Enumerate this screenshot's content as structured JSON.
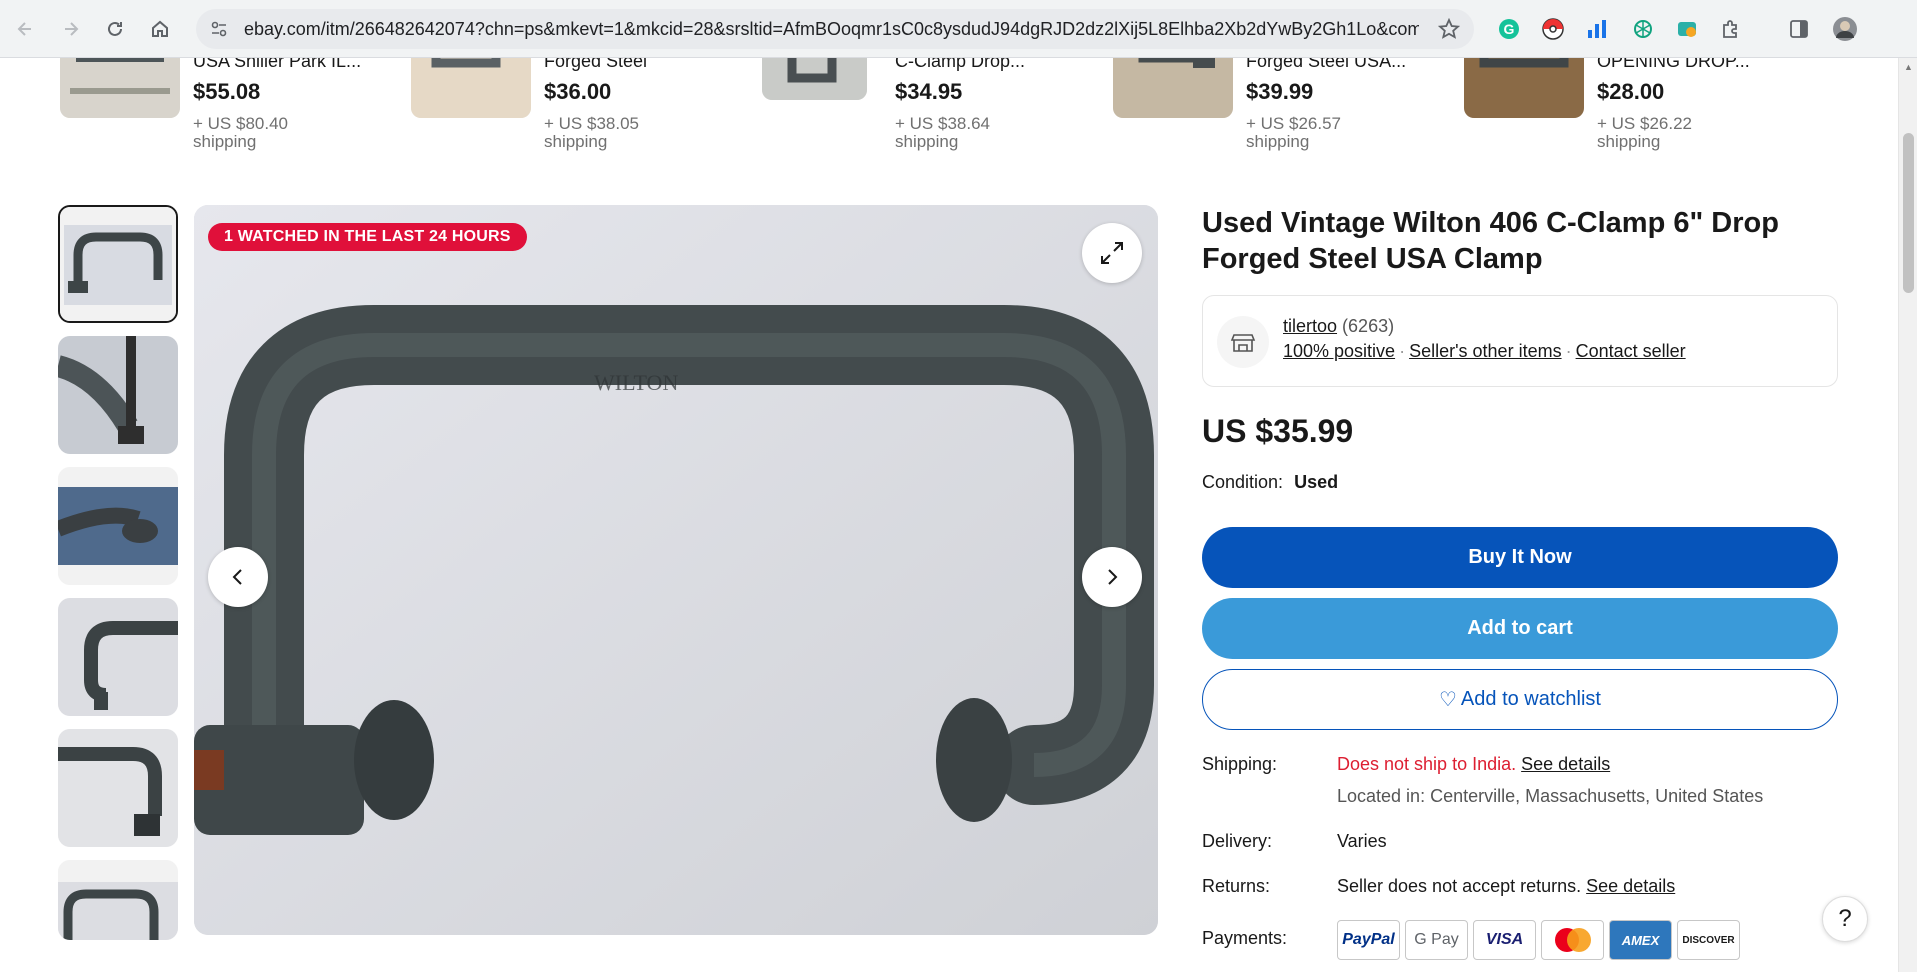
{
  "browser": {
    "url": "ebay.com/itm/266482642074?chn=ps&mkevt=1&mkcid=28&srsltid=AfmBOoqmr1sC0c8ysdudJ94dgRJD2dz2lXij5L8Elhba2Xb2dYwBy2Gh1Lo&com_cvv...",
    "back_icon": "back-arrow-icon",
    "forward_icon": "forward-arrow-icon",
    "reload_icon": "reload-icon",
    "home_icon": "home-icon"
  },
  "similar_items": [
    {
      "title": "USA Shiller Park IL...",
      "price": "$55.08",
      "shipping_line1": "+ US $80.40",
      "shipping_line2": "shipping"
    },
    {
      "title": "Forged Steel",
      "price": "$36.00",
      "shipping_line1": "+ US $38.05",
      "shipping_line2": "shipping"
    },
    {
      "title": "C-Clamp Drop...",
      "price": "$34.95",
      "shipping_line1": "+ US $38.64",
      "shipping_line2": "shipping"
    },
    {
      "title": "Forged Steel USA...",
      "price": "$39.99",
      "shipping_line1": "+ US $26.57",
      "shipping_line2": "shipping"
    },
    {
      "title": "OPENING DROP...",
      "price": "$28.00",
      "shipping_line1": "+ US $26.22",
      "shipping_line2": "shipping"
    }
  ],
  "gallery": {
    "badge": "1 WATCHED IN THE LAST 24 HOURS",
    "image_alt": "WILTON",
    "thumbnail_count": 6
  },
  "product": {
    "title": "Used Vintage Wilton 406 C-Clamp 6\" Drop Forged Steel USA Clamp",
    "seller_name": "tilertoo",
    "seller_feedback": "(6263)",
    "seller_positive": "100% positive",
    "seller_other_items": "Seller's other items",
    "contact_seller": "Contact seller",
    "price": "US $35.99",
    "condition_label": "Condition:",
    "condition_value": "Used",
    "buy_now": "Buy It Now",
    "add_to_cart": "Add to cart",
    "add_to_watchlist": "Add to watchlist"
  },
  "details": {
    "shipping_label": "Shipping:",
    "shipping_value": "Does not ship to India.",
    "shipping_link": "See details",
    "located": "Located in: Centerville, Massachusetts, United States",
    "delivery_label": "Delivery:",
    "delivery_value": "Varies",
    "returns_label": "Returns:",
    "returns_value": "Seller does not accept returns.",
    "returns_link": "See details",
    "payments_label": "Payments:",
    "payment_methods": [
      "PayPal",
      "G Pay",
      "VISA",
      "Mastercard",
      "AMEX",
      "DISCOVER"
    ]
  },
  "help": "?",
  "colors": {
    "buy_now": "#0654ba",
    "add_to_cart": "#3a9ad9",
    "badge": "#e0103a",
    "not_ship": "#dd1e31"
  }
}
